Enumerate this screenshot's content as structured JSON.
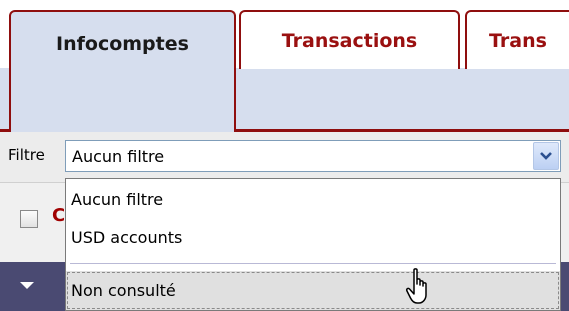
{
  "tabs": [
    {
      "label": "Infocomptes",
      "active": true
    },
    {
      "label": "Transactions",
      "active": false
    },
    {
      "label": "Trans",
      "active": false
    }
  ],
  "filter": {
    "label": "Filtre",
    "selected": "Aucun filtre",
    "options": [
      "Aucun filtre",
      "USD accounts",
      "Non consulté"
    ],
    "hovered_option": "Non consulté"
  },
  "list": {
    "column_peek": "C"
  },
  "icons": {
    "dropdown": "chevron-down-icon",
    "row": "caret-down-icon",
    "cursor": "hand-pointer-icon"
  },
  "colors": {
    "accent": "#8f0e0e",
    "tab_band": "#d6deee",
    "row_dark": "#4a4a72"
  }
}
